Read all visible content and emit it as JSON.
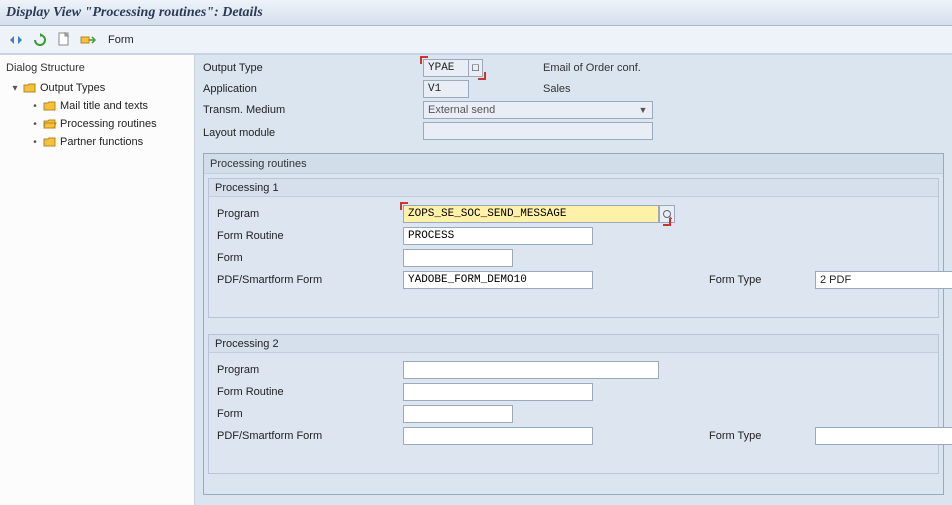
{
  "title": "Display View \"Processing routines\": Details",
  "toolbar": {
    "form_label": "Form"
  },
  "sidebar": {
    "header": "Dialog Structure",
    "root": {
      "label": "Output Types"
    },
    "children": [
      {
        "label": "Mail title and texts"
      },
      {
        "label": "Processing routines"
      },
      {
        "label": "Partner functions"
      }
    ]
  },
  "header": {
    "output_type_label": "Output Type",
    "output_type_value": "YPAE",
    "output_type_desc": "Email of Order conf.",
    "application_label": "Application",
    "application_value": "V1",
    "application_desc": "Sales",
    "transm_label": "Transm. Medium",
    "transm_value": "External send",
    "layout_label": "Layout module",
    "layout_value": ""
  },
  "group": {
    "title": "Processing routines",
    "p1": {
      "title": "Processing 1",
      "program_label": "Program",
      "program_value": "ZOPS_SE_SOC_SEND_MESSAGE",
      "routine_label": "Form Routine",
      "routine_value": "PROCESS",
      "form_label": "Form",
      "form_value": "",
      "pdf_label": "PDF/Smartform Form",
      "pdf_value": "YADOBE_FORM_DEMO10",
      "formtype_label": "Form Type",
      "formtype_value": "2 PDF"
    },
    "p2": {
      "title": "Processing 2",
      "program_label": "Program",
      "program_value": "",
      "routine_label": "Form Routine",
      "routine_value": "",
      "form_label": "Form",
      "form_value": "",
      "pdf_label": "PDF/Smartform Form",
      "pdf_value": "",
      "formtype_label": "Form Type",
      "formtype_value": ""
    }
  }
}
